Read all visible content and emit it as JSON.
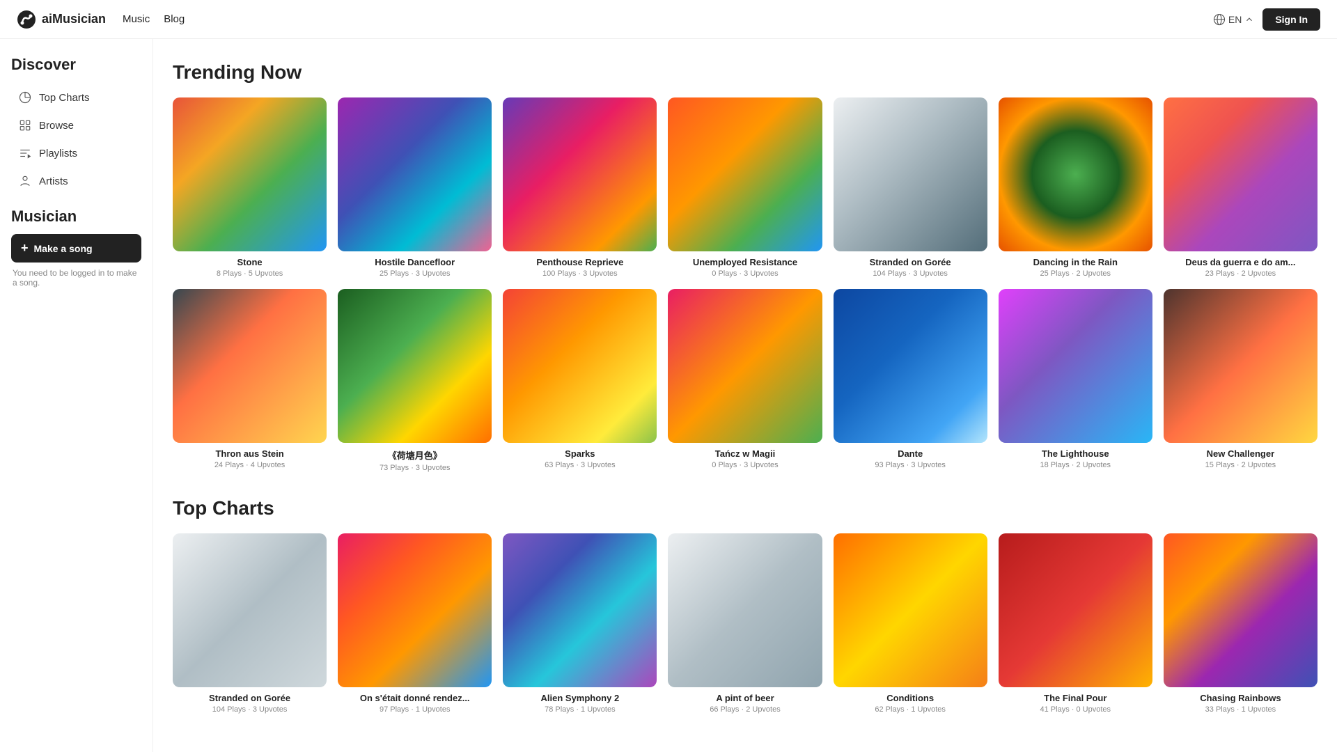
{
  "header": {
    "logo_text": "aiMusician",
    "nav": [
      {
        "label": "Music",
        "href": "#"
      },
      {
        "label": "Blog",
        "href": "#"
      }
    ],
    "lang": "EN",
    "sign_in": "Sign In"
  },
  "sidebar": {
    "discover_title": "Discover",
    "items": [
      {
        "id": "top-charts",
        "label": "Top Charts",
        "icon": "chart"
      },
      {
        "id": "browse",
        "label": "Browse",
        "icon": "grid"
      },
      {
        "id": "playlists",
        "label": "Playlists",
        "icon": "playlist"
      },
      {
        "id": "artists",
        "label": "Artists",
        "icon": "mic"
      }
    ],
    "musician_title": "Musician",
    "make_song_label": "Make a song",
    "make_song_hint": "You need to be logged in to make a song."
  },
  "trending_now": {
    "section_title": "Trending Now",
    "items": [
      {
        "name": "Stone",
        "plays": "8 Plays",
        "upvotes": "5 Upvotes",
        "thumb": "thumb-1"
      },
      {
        "name": "Hostile Dancefloor",
        "plays": "25 Plays",
        "upvotes": "3 Upvotes",
        "thumb": "thumb-2"
      },
      {
        "name": "Penthouse Reprieve",
        "plays": "100 Plays",
        "upvotes": "3 Upvotes",
        "thumb": "thumb-3"
      },
      {
        "name": "Unemployed Resistance",
        "plays": "0 Plays",
        "upvotes": "3 Upvotes",
        "thumb": "thumb-4"
      },
      {
        "name": "Stranded on Gorée",
        "plays": "104 Plays",
        "upvotes": "3 Upvotes",
        "thumb": "thumb-5"
      },
      {
        "name": "Dancing in the Rain",
        "plays": "25 Plays",
        "upvotes": "2 Upvotes",
        "thumb": "thumb-6"
      },
      {
        "name": "Deus da guerra e do am...",
        "plays": "23 Plays",
        "upvotes": "2 Upvotes",
        "thumb": "thumb-7"
      },
      {
        "name": "Thron aus Stein",
        "plays": "24 Plays",
        "upvotes": "4 Upvotes",
        "thumb": "thumb-8"
      },
      {
        "name": "《荷塘月色》",
        "plays": "73 Plays",
        "upvotes": "3 Upvotes",
        "thumb": "thumb-9"
      },
      {
        "name": "Sparks",
        "plays": "63 Plays",
        "upvotes": "3 Upvotes",
        "thumb": "thumb-10"
      },
      {
        "name": "Tańcz w Magii",
        "plays": "0 Plays",
        "upvotes": "3 Upvotes",
        "thumb": "thumb-11"
      },
      {
        "name": "Dante",
        "plays": "93 Plays",
        "upvotes": "3 Upvotes",
        "thumb": "thumb-12"
      },
      {
        "name": "The Lighthouse",
        "plays": "18 Plays",
        "upvotes": "2 Upvotes",
        "thumb": "thumb-13"
      },
      {
        "name": "New Challenger",
        "plays": "15 Plays",
        "upvotes": "2 Upvotes",
        "thumb": "thumb-14"
      }
    ]
  },
  "top_charts": {
    "section_title": "Top Charts",
    "items": [
      {
        "name": "Stranded on Gorée",
        "plays": "104 Plays",
        "upvotes": "3 Upvotes",
        "thumb": "thumb-tc1"
      },
      {
        "name": "On s'était donné rendez...",
        "plays": "97 Plays",
        "upvotes": "1 Upvotes",
        "thumb": "thumb-tc2"
      },
      {
        "name": "Alien Symphony 2",
        "plays": "78 Plays",
        "upvotes": "1 Upvotes",
        "thumb": "thumb-tc3"
      },
      {
        "name": "A pint of beer",
        "plays": "66 Plays",
        "upvotes": "2 Upvotes",
        "thumb": "thumb-tc4"
      },
      {
        "name": "Conditions",
        "plays": "62 Plays",
        "upvotes": "1 Upvotes",
        "thumb": "thumb-tc5"
      },
      {
        "name": "The Final Pour",
        "plays": "41 Plays",
        "upvotes": "0 Upvotes",
        "thumb": "thumb-tc6"
      },
      {
        "name": "Chasing Rainbows",
        "plays": "33 Plays",
        "upvotes": "1 Upvotes",
        "thumb": "thumb-tc7"
      }
    ]
  }
}
